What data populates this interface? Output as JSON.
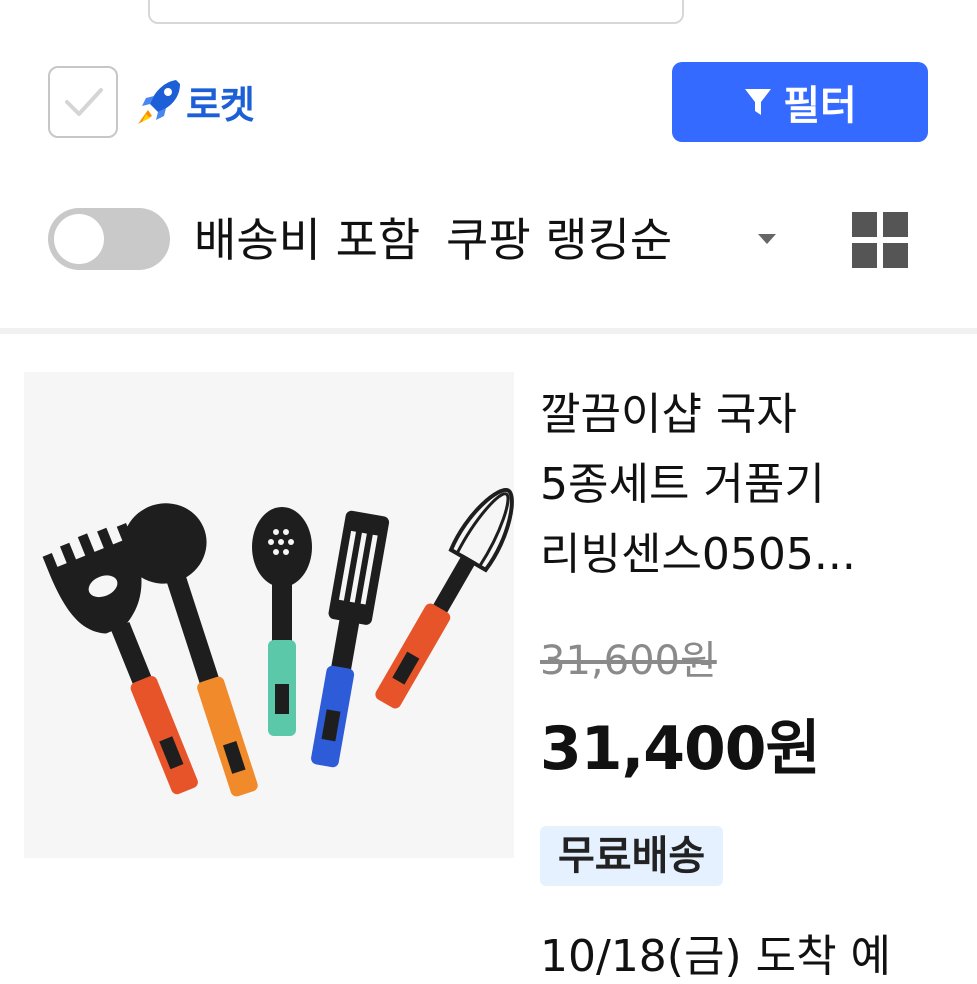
{
  "filters": {
    "rocket_label": "로켓",
    "filter_button_label": "필터",
    "shipping_toggle_label": "배송비 포함",
    "sort_label": "쿠팡 랭킹순"
  },
  "product": {
    "title": "깔끔이샵 국자 5종세트 거품기 리빙센스0505...",
    "original_price": "31,600원",
    "sale_price": "31,400원",
    "badge": "무료배송",
    "arrival": "10/18(금) 도착 예"
  },
  "colors": {
    "accent": "#346aff",
    "rocket_blue": "#1d5fd6",
    "badge_bg": "#e5f1ff"
  },
  "icons": {
    "filter": "funnel-icon",
    "rocket": "rocket-icon",
    "view": "grid-view-icon",
    "sort": "caret-down-icon"
  }
}
